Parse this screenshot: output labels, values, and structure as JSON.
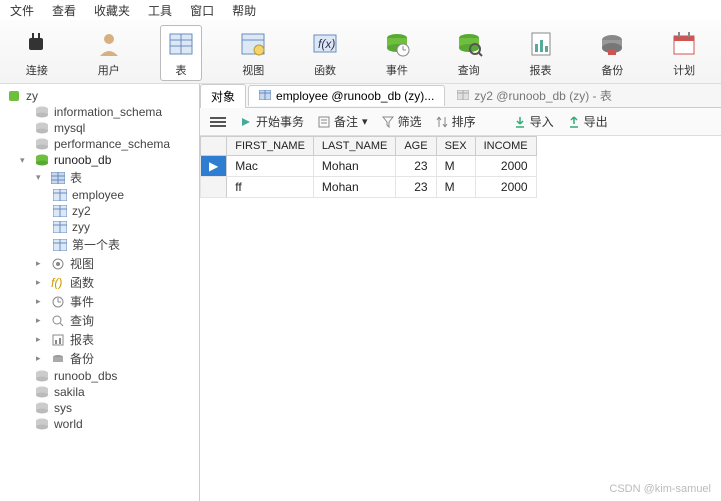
{
  "menu": [
    "文件",
    "查看",
    "收藏夹",
    "工具",
    "窗口",
    "帮助"
  ],
  "ribbon": [
    {
      "label": "连接",
      "icon": "plug"
    },
    {
      "label": "用户",
      "icon": "user"
    },
    {
      "label": "表",
      "icon": "table",
      "active": true
    },
    {
      "label": "视图",
      "icon": "view"
    },
    {
      "label": "函数",
      "icon": "fx"
    },
    {
      "label": "事件",
      "icon": "event"
    },
    {
      "label": "查询",
      "icon": "query"
    },
    {
      "label": "报表",
      "icon": "report"
    },
    {
      "label": "备份",
      "icon": "backup"
    },
    {
      "label": "计划",
      "icon": "plan"
    }
  ],
  "tree": {
    "root": "zy",
    "dbs": [
      "information_schema",
      "mysql",
      "performance_schema"
    ],
    "open_db": "runoob_db",
    "tables_label": "表",
    "tables": [
      "employee",
      "zy2",
      "zyy",
      "第一个表"
    ],
    "folders": [
      "视图",
      "函数",
      "事件",
      "查询",
      "报表",
      "备份"
    ],
    "other_dbs": [
      "runoob_dbs",
      "sakila",
      "sys",
      "world"
    ]
  },
  "tabs": {
    "t0": "对象",
    "t1": "employee @runoob_db (zy)...",
    "t2": "zy2 @runoob_db (zy) - 表"
  },
  "toolbar": {
    "start": "开始事务",
    "note": "备注",
    "filter": "筛选",
    "sort": "排序",
    "import": "导入",
    "export": "导出"
  },
  "grid": {
    "cols": [
      "FIRST_NAME",
      "LAST_NAME",
      "AGE",
      "SEX",
      "INCOME"
    ],
    "rows": [
      {
        "sel": true,
        "c": [
          "Mac",
          "Mohan",
          "23",
          "M",
          "2000"
        ]
      },
      {
        "sel": false,
        "c": [
          "ff",
          "Mohan",
          "23",
          "M",
          "2000"
        ]
      }
    ]
  },
  "watermark": "CSDN @kim-samuel"
}
